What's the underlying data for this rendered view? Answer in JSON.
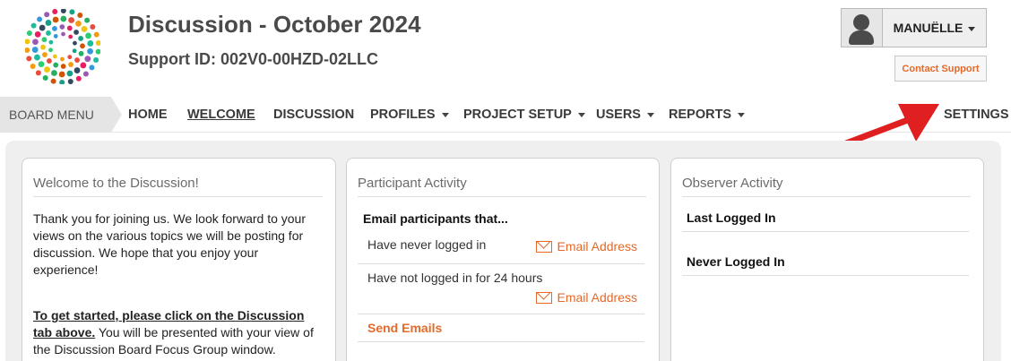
{
  "header": {
    "title": "Discussion - October 2024",
    "support_id": "Support ID: 002V0-00HZD-02LLC",
    "user_name": "MANUËLLE",
    "contact_support": "Contact Support",
    "logo_colors": [
      "#e74c3c",
      "#f39c12",
      "#f1c40f",
      "#2ecc71",
      "#1abc9c",
      "#3498db",
      "#9b59b6",
      "#e91e63",
      "#34495e",
      "#16a085",
      "#d35400",
      "#27ae60"
    ]
  },
  "nav": {
    "board_menu": "BOARD MENU",
    "items": [
      {
        "label": "HOME"
      },
      {
        "label": "WELCOME"
      },
      {
        "label": "DISCUSSION"
      },
      {
        "label": "PROFILES"
      },
      {
        "label": "PROJECT SETUP"
      },
      {
        "label": "USERS"
      },
      {
        "label": "REPORTS"
      },
      {
        "label": "SETTINGS"
      }
    ]
  },
  "welcome": {
    "title": "Welcome to the Discussion!",
    "paragraph1": "Thank you for joining us. We look forward to your views on the various topics we will be posting for discussion. We hope that you enjoy your experience!",
    "bold_link": "To get started, please click on the Discussion tab above.",
    "paragraph2_rest": " You will be presented with your view of the Discussion Board Focus Group window."
  },
  "participant": {
    "title": "Participant Activity",
    "subhead": "Email participants that...",
    "rows": [
      {
        "label": "Have never logged in",
        "action": "Email Address"
      },
      {
        "label": "Have not logged in for 24 hours",
        "action": "Email Address"
      }
    ],
    "send": "Send Emails"
  },
  "observer": {
    "title": "Observer Activity",
    "rows": [
      {
        "label": "Last Logged In"
      },
      {
        "label": "Never Logged In"
      }
    ]
  },
  "colors": {
    "accent": "#e4692a",
    "annotation_arrow": "#e02020"
  }
}
